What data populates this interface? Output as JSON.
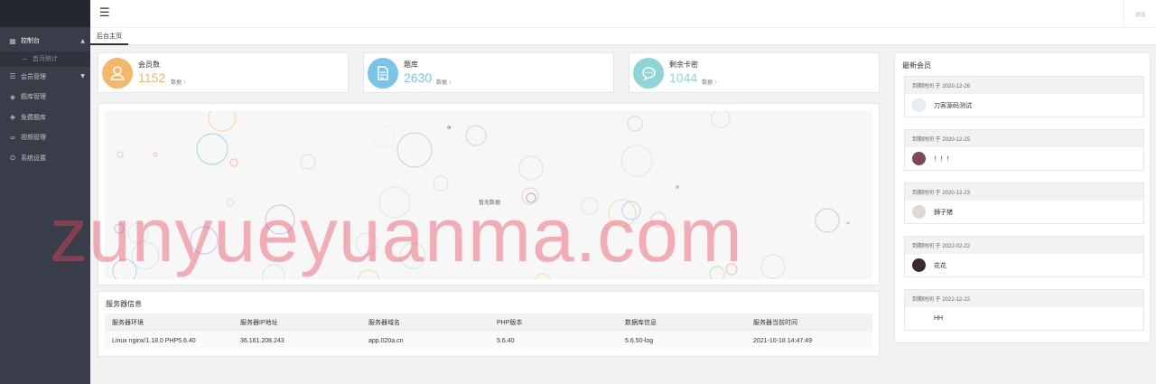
{
  "header": {
    "menu_icon": "☰",
    "logout_label": "退出"
  },
  "sidebar": {
    "items": [
      {
        "label": "控制台",
        "icon": "grid-icon",
        "glyph": "▦",
        "arrow": "▲",
        "active": true
      },
      {
        "label": "会员管理",
        "icon": "list-icon",
        "glyph": "☰",
        "arrow": "▼"
      },
      {
        "label": "题库管理",
        "icon": "layers-icon",
        "glyph": "◈"
      },
      {
        "label": "免费题库",
        "icon": "layers-icon",
        "glyph": "◈"
      },
      {
        "label": "视频管理",
        "icon": "link-icon",
        "glyph": "∞"
      },
      {
        "label": "系统设置",
        "icon": "settings-icon",
        "glyph": "⊙"
      }
    ],
    "sub_items": [
      {
        "label": "首页统计"
      }
    ]
  },
  "tabs": [
    {
      "label": "后台主页"
    }
  ],
  "stats": [
    {
      "label": "会员数",
      "value": "1152",
      "unit": "数据",
      "arrow": "↑",
      "color": "#f5b76a",
      "icon": "user-icon"
    },
    {
      "label": "题库",
      "value": "2630",
      "unit": "数据",
      "arrow": "↑",
      "color": "#79c4e8",
      "icon": "document-icon"
    },
    {
      "label": "剩余卡密",
      "value": "1044",
      "unit": "数据",
      "arrow": "↑",
      "color": "#8fd5d8",
      "icon": "chat-icon"
    }
  ],
  "chart": {
    "empty_text": "暂无数据"
  },
  "server": {
    "title": "服务器信息",
    "columns": [
      "服务器环境",
      "服务器IP地址",
      "服务器域名",
      "PHP版本",
      "数据库信息",
      "服务器当前时间"
    ],
    "rows": [
      [
        "Linux nginx/1.18.0 PHP5.6.40",
        "36.161.208.243",
        "app.020a.cn",
        "5.6.40",
        "5.6.50-log",
        "2021-10-18 14:47:49"
      ]
    ]
  },
  "members": {
    "title": "最新会员",
    "items": [
      {
        "expire_label": "到期时间 于 2020-12-26",
        "name": "刀客源码测试"
      },
      {
        "expire_label": "到期时间 于 2020-12-25",
        "name": "！！！"
      },
      {
        "expire_label": "到期时间 于 2020-12-23",
        "name": "狮子猪"
      },
      {
        "expire_label": "到期时间 于 2022-02-22",
        "name": "花花"
      },
      {
        "expire_label": "到期时间 于 2022-12-22",
        "name": "HH"
      }
    ]
  },
  "watermark": "zunyueyuanma.com"
}
